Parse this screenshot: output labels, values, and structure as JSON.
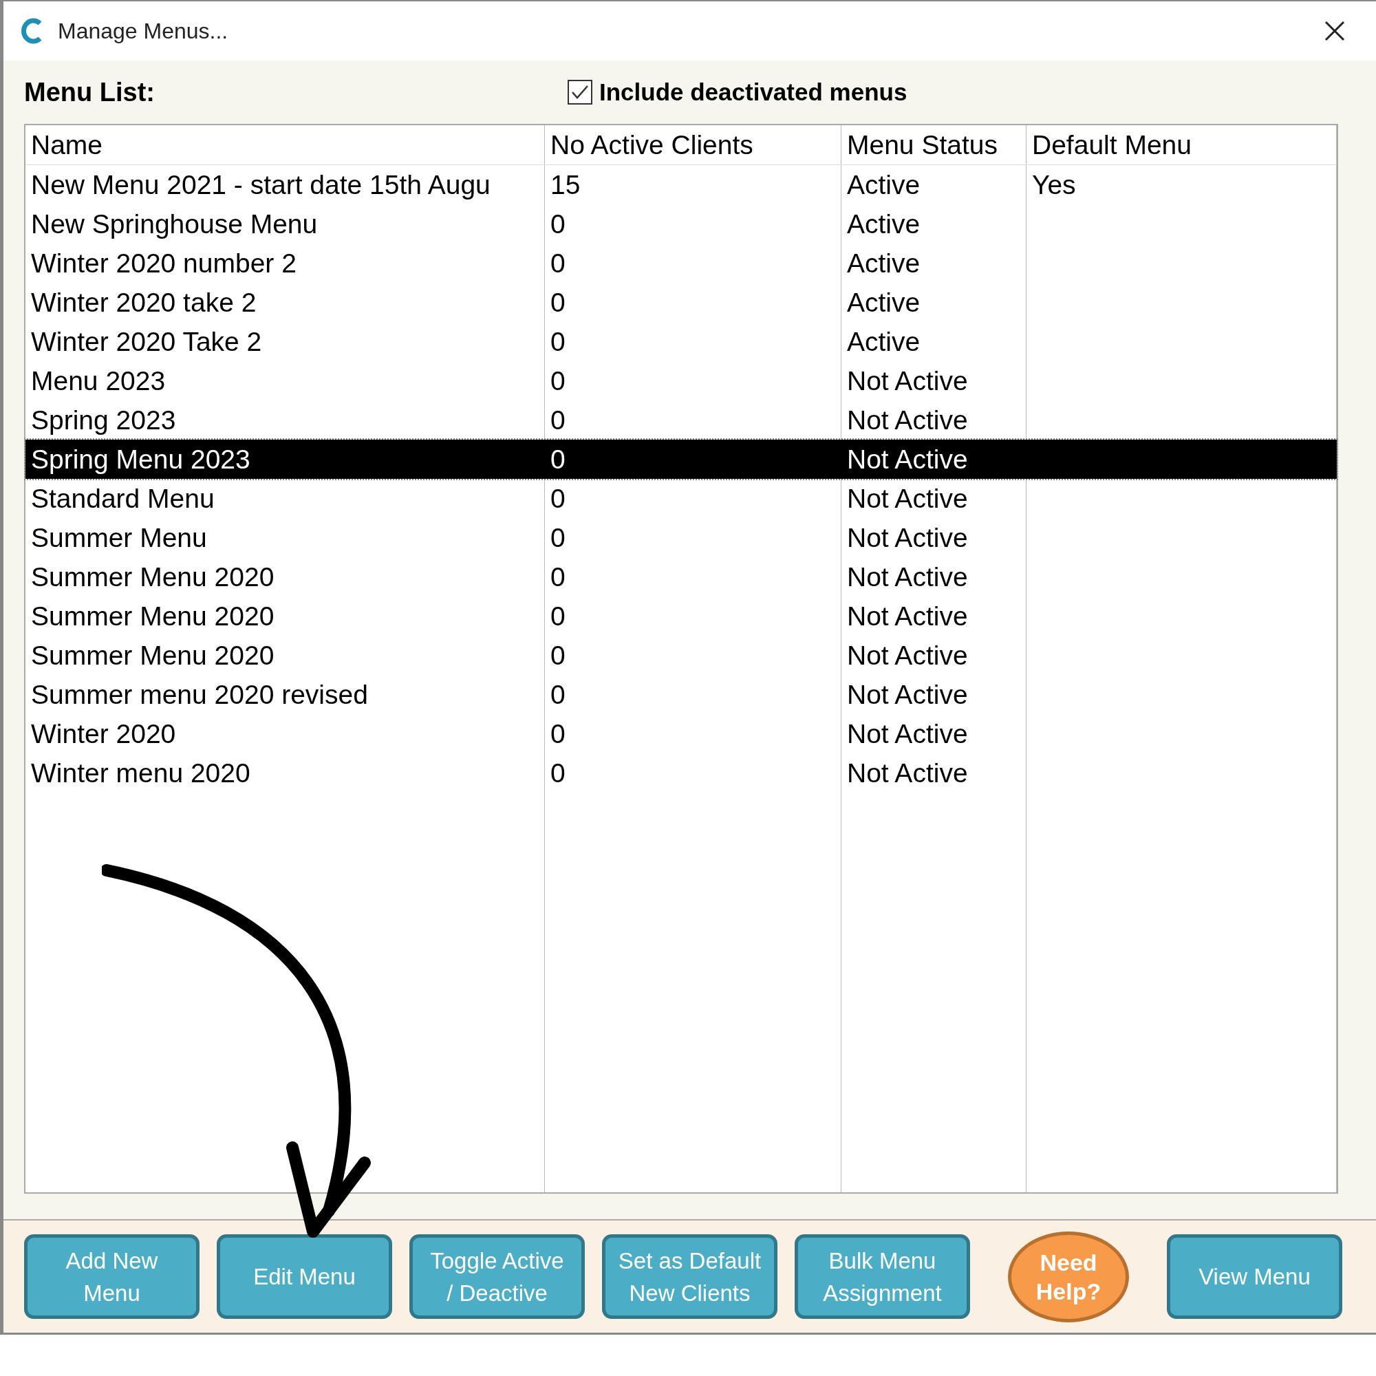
{
  "window": {
    "title": "Manage Menus..."
  },
  "menu_list": {
    "label": "Menu List:",
    "include_deactivated": {
      "label": "Include deactivated menus",
      "checked": true
    }
  },
  "table": {
    "columns": [
      "Name",
      "No Active Clients",
      "Menu Status",
      "Default Menu"
    ],
    "rows": [
      {
        "cells": [
          "New Menu 2021 - start date 15th Augu",
          "15",
          "Active",
          "Yes"
        ],
        "selected": false
      },
      {
        "cells": [
          "New Springhouse Menu",
          "0",
          "Active",
          ""
        ],
        "selected": false
      },
      {
        "cells": [
          "Winter 2020 number 2",
          "0",
          "Active",
          ""
        ],
        "selected": false
      },
      {
        "cells": [
          "Winter 2020 take 2",
          "0",
          "Active",
          ""
        ],
        "selected": false
      },
      {
        "cells": [
          "Winter 2020 Take 2",
          "0",
          "Active",
          ""
        ],
        "selected": false
      },
      {
        "cells": [
          "Menu 2023",
          "0",
          "Not Active",
          ""
        ],
        "selected": false
      },
      {
        "cells": [
          "Spring 2023",
          "0",
          "Not Active",
          ""
        ],
        "selected": false
      },
      {
        "cells": [
          "Spring Menu 2023",
          "0",
          "Not Active",
          ""
        ],
        "selected": true
      },
      {
        "cells": [
          "Standard Menu",
          "0",
          "Not Active",
          ""
        ],
        "selected": false
      },
      {
        "cells": [
          "Summer Menu",
          "0",
          "Not Active",
          ""
        ],
        "selected": false
      },
      {
        "cells": [
          "Summer Menu 2020",
          "0",
          "Not Active",
          ""
        ],
        "selected": false
      },
      {
        "cells": [
          "Summer Menu 2020",
          "0",
          "Not Active",
          ""
        ],
        "selected": false
      },
      {
        "cells": [
          "Summer Menu 2020",
          "0",
          "Not Active",
          ""
        ],
        "selected": false
      },
      {
        "cells": [
          "Summer menu 2020 revised",
          "0",
          "Not Active",
          ""
        ],
        "selected": false
      },
      {
        "cells": [
          "Winter 2020",
          "0",
          "Not Active",
          ""
        ],
        "selected": false
      },
      {
        "cells": [
          "Winter menu 2020",
          "0",
          "Not Active",
          ""
        ],
        "selected": false
      }
    ]
  },
  "buttons": [
    {
      "kind": "action",
      "lines": [
        "Add New",
        "Menu"
      ]
    },
    {
      "kind": "action",
      "lines": [
        "Edit Menu"
      ]
    },
    {
      "kind": "action",
      "lines": [
        "Toggle Active",
        "/ Deactive"
      ]
    },
    {
      "kind": "action",
      "lines": [
        "Set as Default",
        "New Clients"
      ]
    },
    {
      "kind": "action",
      "lines": [
        "Bulk Menu",
        "Assignment"
      ]
    },
    {
      "kind": "help",
      "lines": [
        "Need",
        "Help?"
      ]
    },
    {
      "kind": "action",
      "lines": [
        "View Menu"
      ]
    }
  ]
}
